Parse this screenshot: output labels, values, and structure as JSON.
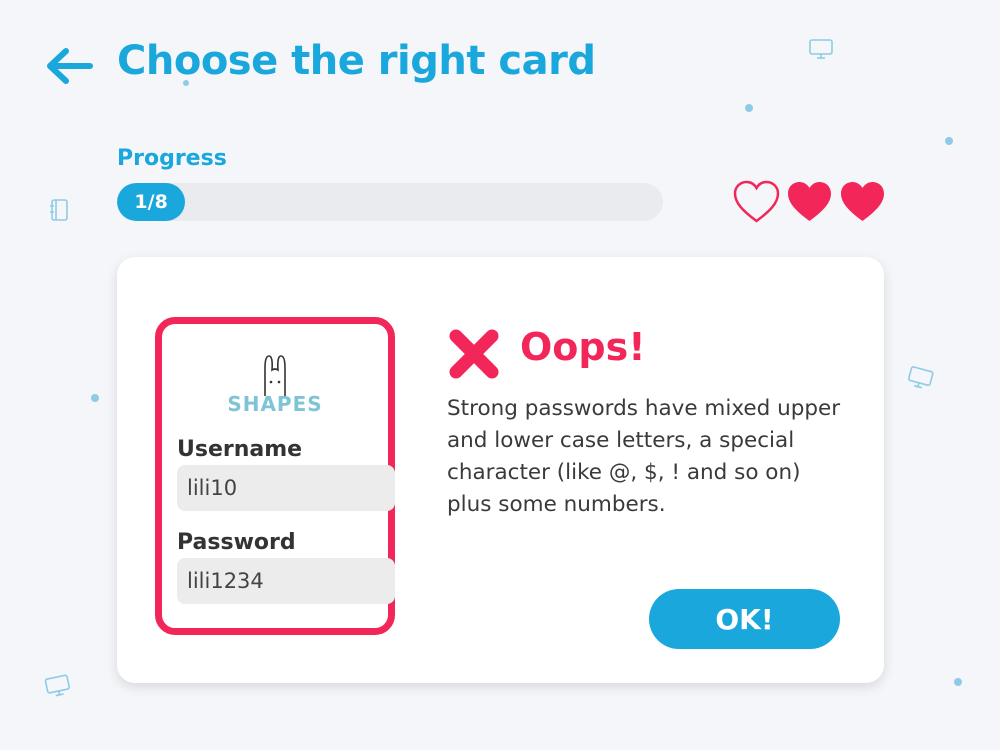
{
  "header": {
    "back_icon": "arrow-left-icon",
    "title": "Choose the right card"
  },
  "progress": {
    "label": "Progress",
    "text": "1/8",
    "current": 1,
    "total": 8
  },
  "lives": {
    "icon": "heart-icon",
    "items": [
      {
        "state": "empty"
      },
      {
        "state": "full"
      },
      {
        "state": "full"
      }
    ]
  },
  "login_card": {
    "logo_text": "SHAPES",
    "username_label": "Username",
    "username_value": "lili10",
    "password_label": "Password",
    "password_value": "lili1234"
  },
  "feedback": {
    "icon": "x-mark-icon",
    "title": "Oops!",
    "message": "Strong passwords have mixed upper and lower case letters, a special character (like @, $, ! and so on) plus some numbers.",
    "ok_label": "OK!"
  },
  "colors": {
    "accent": "#1aa7dc",
    "error": "#f3265a",
    "background": "#f4f6fa"
  }
}
